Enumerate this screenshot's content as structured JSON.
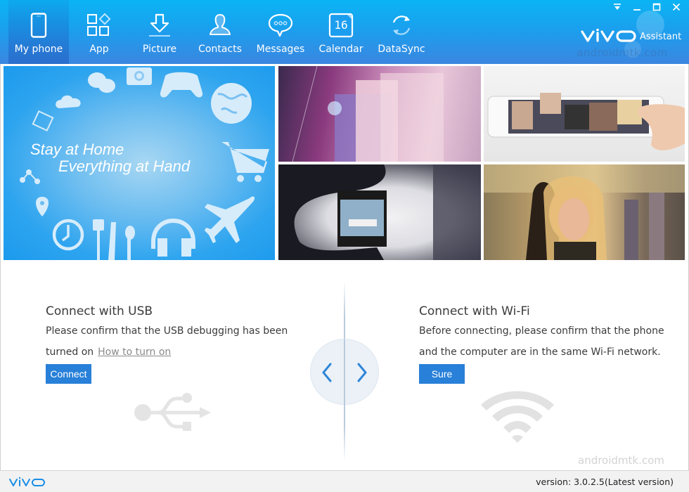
{
  "app": {
    "brand": "vivo",
    "product": "Assistant",
    "watermark": "androidmtk.com"
  },
  "window_controls": {
    "menu": "dropdown-menu",
    "minimize": "minimize",
    "maximize": "maximize",
    "close": "close"
  },
  "nav": {
    "active": "My phone",
    "items": [
      {
        "label": "My phone",
        "icon": "phone-icon"
      },
      {
        "label": "App",
        "icon": "apps-icon"
      },
      {
        "label": "Picture",
        "icon": "download-icon"
      },
      {
        "label": "Contacts",
        "icon": "contact-icon"
      },
      {
        "label": "Messages",
        "icon": "message-icon"
      },
      {
        "label": "Calendar",
        "icon": "calendar-icon",
        "badge": "16"
      },
      {
        "label": "DataSync",
        "icon": "sync-icon"
      }
    ]
  },
  "banner": {
    "line1": "Stay at Home",
    "line2": "Everything at Hand",
    "icons": [
      "chat-icon",
      "camera-icon",
      "gamepad-icon",
      "globe-icon",
      "cloud-icon",
      "film-icon",
      "share-icon",
      "location-icon",
      "cart-icon",
      "airplane-icon",
      "clock-icon",
      "cutlery-icon",
      "headphones-icon"
    ]
  },
  "gallery": [
    {
      "subject": "pocket-phone-photo"
    },
    {
      "subject": "phone-gallery-photo"
    },
    {
      "subject": "film-negative-photo"
    },
    {
      "subject": "music-listener-photo"
    }
  ],
  "usb": {
    "title": "Connect with USB",
    "text": "Please confirm that the USB debugging has been",
    "text2": "turned on",
    "link": "How to turn on",
    "button": "Connect"
  },
  "wifi": {
    "title": "Connect with Wi-Fi",
    "text": "Before connecting, please confirm that the phone",
    "text2": "and the computer are in the same Wi-Fi network.",
    "button": "Sure"
  },
  "switcher": {
    "prev": "previous",
    "next": "next"
  },
  "footer": {
    "logo": "vivo",
    "version": "version: 3.0.2.5(Latest version)"
  },
  "colors": {
    "accent": "#2880d8",
    "header_top": "#0bb4f4",
    "header_bottom": "#3b86e0",
    "banner": "#1c9aed",
    "brand_blue": "#1a8ee6"
  }
}
